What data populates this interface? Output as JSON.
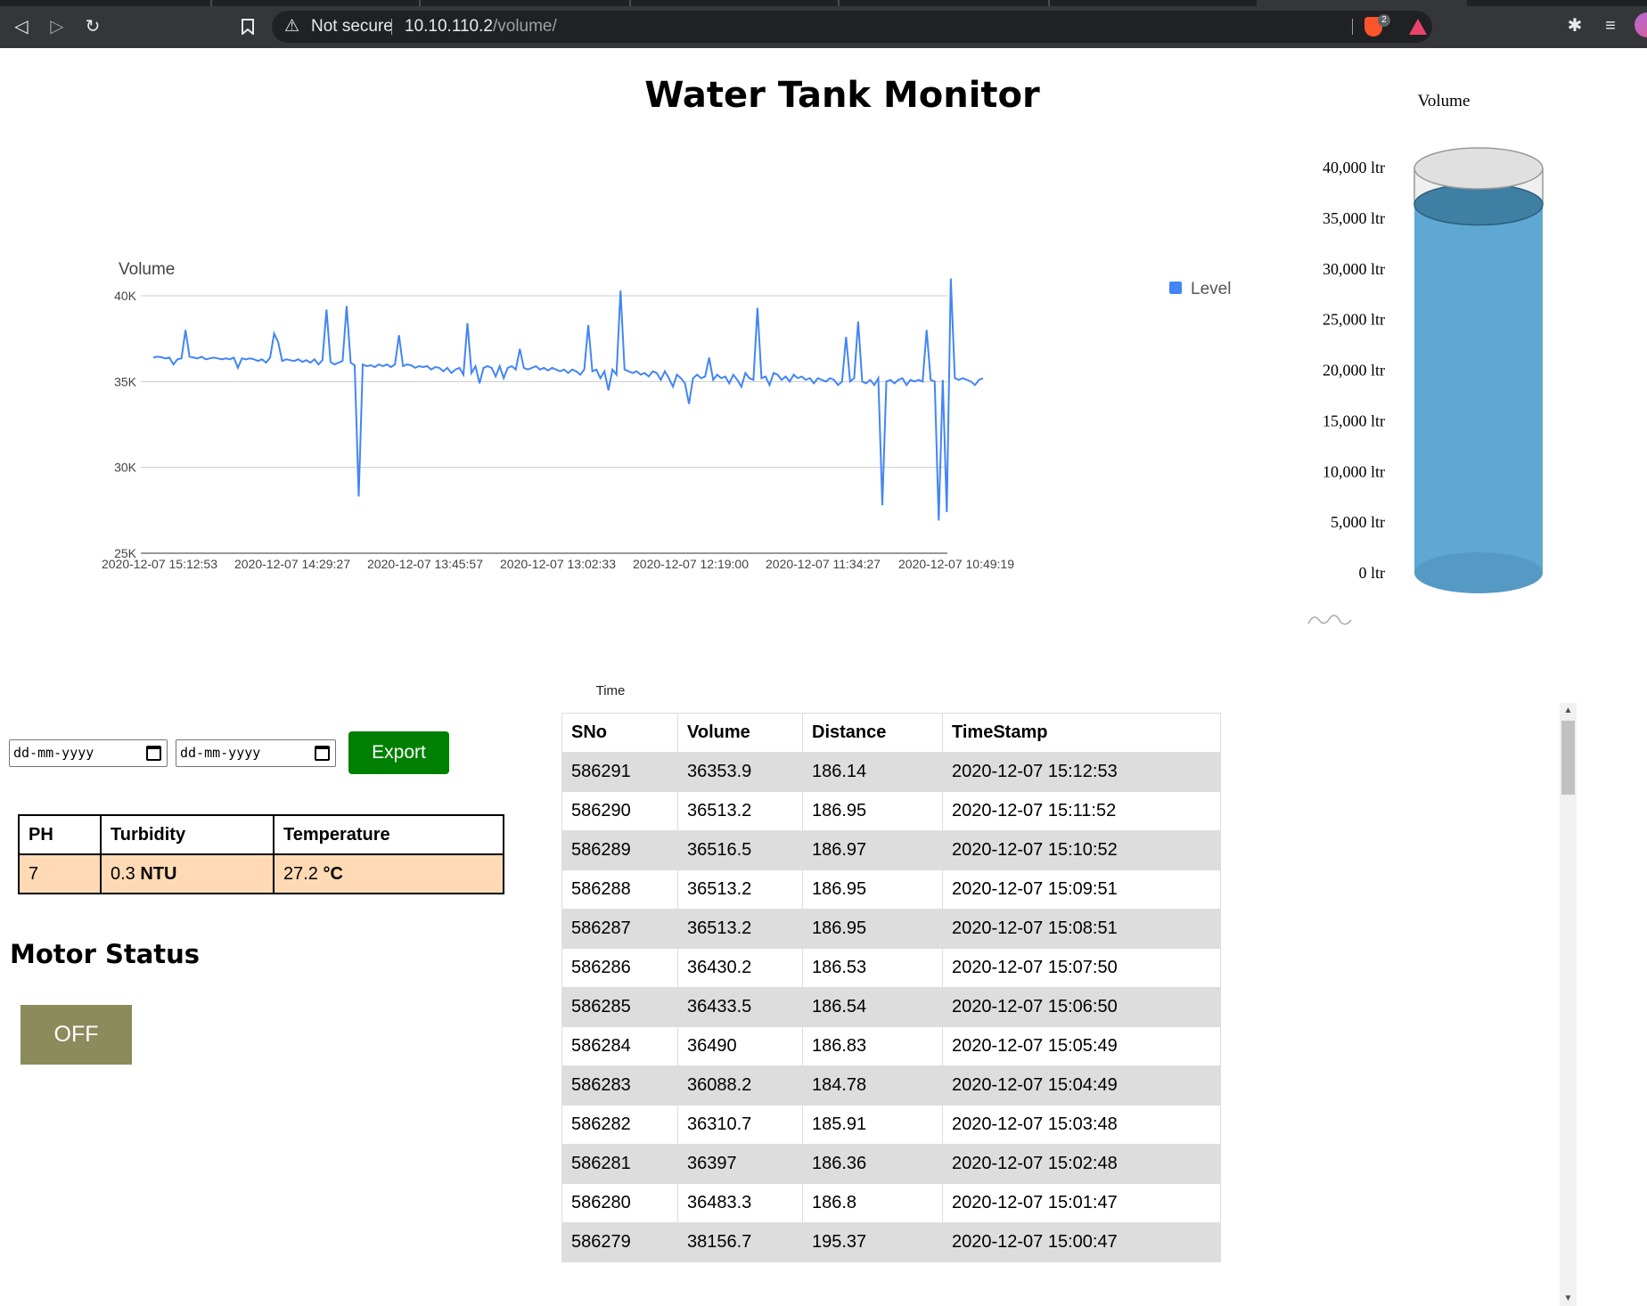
{
  "browser": {
    "security_label": "Not secure",
    "url_host": "10.10.110.2",
    "url_path": "/volume/",
    "brave_badge_count": "2",
    "icons": [
      "back-icon",
      "forward-icon",
      "reload-icon",
      "bookmark-icon",
      "warning-icon",
      "brave-shield-icon",
      "brave-rewards-icon",
      "extensions-icon",
      "media-queue-icon",
      "profile-avatar"
    ]
  },
  "page": {
    "title": "Water Tank Monitor"
  },
  "chart_data": [
    {
      "type": "line",
      "title": "Volume",
      "xlabel": "Time",
      "ylabel": "",
      "ylim": [
        25000,
        40000
      ],
      "y_ticks": [
        "40K",
        "35K",
        "30K",
        "25K"
      ],
      "y_tick_values": [
        40000,
        35000,
        30000,
        25000
      ],
      "x_tick_labels": [
        "2020-12-07 15:12:53",
        "2020-12-07 14:29:27",
        "2020-12-07 13:45:57",
        "2020-12-07 13:02:33",
        "2020-12-07 12:19:00",
        "2020-12-07 11:34:27",
        "2020-12-07 10:49:19"
      ],
      "legend": "right",
      "grid": true,
      "series": [
        {
          "name": "Level",
          "color": "#4285f4",
          "values": [
            36400,
            36450,
            36420,
            36350,
            36400,
            36000,
            36300,
            36350,
            38000,
            36450,
            36400,
            36350,
            36450,
            36300,
            36350,
            36400,
            36350,
            36300,
            36350,
            36300,
            36400,
            35800,
            36350,
            36300,
            36350,
            36300,
            36200,
            36300,
            36100,
            36400,
            37800,
            37300,
            36200,
            36300,
            36250,
            36200,
            36300,
            36150,
            36250,
            36100,
            36300,
            36000,
            36250,
            39200,
            36150,
            36000,
            36100,
            36200,
            39400,
            36100,
            35950,
            28300,
            36000,
            35900,
            35950,
            35850,
            36000,
            35900,
            36000,
            35850,
            36000,
            37700,
            35900,
            36000,
            35950,
            35800,
            35900,
            35850,
            35900,
            35700,
            35850,
            35800,
            35600,
            35800,
            35500,
            35700,
            35800,
            35400,
            38400,
            35500,
            35900,
            34900,
            35800,
            35900,
            35800,
            35300,
            35900,
            35200,
            35800,
            35900,
            35700,
            36900,
            35800,
            35700,
            35800,
            35900,
            35700,
            35800,
            35650,
            35800,
            35700,
            35600,
            35700,
            35500,
            35700,
            35600,
            35400,
            35700,
            38300,
            35600,
            35700,
            35200,
            35600,
            34500,
            35700,
            35400,
            40300,
            35700,
            35600,
            35500,
            35600,
            35400,
            35500,
            35300,
            35600,
            35500,
            35100,
            35600,
            35200,
            34700,
            35400,
            35200,
            34900,
            33700,
            35200,
            35400,
            35200,
            35300,
            36400,
            35100,
            35400,
            35200,
            35300,
            34900,
            35400,
            35100,
            34700,
            35500,
            35200,
            35100,
            39300,
            35200,
            35300,
            34800,
            35500,
            35400,
            35100,
            35300,
            35000,
            35400,
            35200,
            35300,
            35100,
            35200,
            34900,
            35200,
            35100,
            35000,
            35200,
            35100,
            34800,
            35000,
            37600,
            35000,
            35200,
            38500,
            35000,
            34900,
            35100,
            34800,
            35200,
            27800,
            35000,
            35100,
            34900,
            35100,
            35200,
            34800,
            35100,
            35000,
            35100,
            35000,
            38000,
            35100,
            35000,
            26900,
            35100,
            27400,
            41000,
            35200,
            35100,
            35200,
            35100,
            35000,
            34800,
            35100,
            35200
          ]
        }
      ]
    },
    {
      "type": "bar",
      "title": "Volume",
      "ylim": [
        0,
        40000
      ],
      "y_tick_labels": [
        "40,000 ltr",
        "35,000 ltr",
        "30,000 ltr",
        "25,000 ltr",
        "20,000 ltr",
        "15,000 ltr",
        "10,000 ltr",
        "5,000 ltr",
        "0 ltr"
      ],
      "y_tick_values": [
        40000,
        35000,
        30000,
        25000,
        20000,
        15000,
        10000,
        5000,
        0
      ],
      "values": [
        36353.9
      ],
      "colors": {
        "fill": "#5fa8d3",
        "top": "#3f7fa3",
        "empty": "#e0e0e0"
      }
    }
  ],
  "export": {
    "from_placeholder": "dd-mm-yyyy",
    "to_placeholder": "dd-mm-yyyy",
    "button_label": "Export",
    "button_color": "#008000"
  },
  "sensors": {
    "headers": [
      "PH",
      "Turbidity",
      "Temperature"
    ],
    "ph": "7",
    "turbidity_value": "0.3",
    "turbidity_unit": "NTU",
    "temperature_value": "27.2",
    "temperature_unit": "°C",
    "row_color": "#ffdab5"
  },
  "motor": {
    "title": "Motor Status",
    "state_label": "OFF",
    "button_color": "#8b8b5c"
  },
  "readings_table": {
    "headers": [
      "SNo",
      "Volume",
      "Distance",
      "TimeStamp"
    ],
    "rows": [
      [
        "586291",
        "36353.9",
        "186.14",
        "2020-12-07 15:12:53"
      ],
      [
        "586290",
        "36513.2",
        "186.95",
        "2020-12-07 15:11:52"
      ],
      [
        "586289",
        "36516.5",
        "186.97",
        "2020-12-07 15:10:52"
      ],
      [
        "586288",
        "36513.2",
        "186.95",
        "2020-12-07 15:09:51"
      ],
      [
        "586287",
        "36513.2",
        "186.95",
        "2020-12-07 15:08:51"
      ],
      [
        "586286",
        "36430.2",
        "186.53",
        "2020-12-07 15:07:50"
      ],
      [
        "586285",
        "36433.5",
        "186.54",
        "2020-12-07 15:06:50"
      ],
      [
        "586284",
        "36490",
        "186.83",
        "2020-12-07 15:05:49"
      ],
      [
        "586283",
        "36088.2",
        "184.78",
        "2020-12-07 15:04:49"
      ],
      [
        "586282",
        "36310.7",
        "185.91",
        "2020-12-07 15:03:48"
      ],
      [
        "586281",
        "36397",
        "186.36",
        "2020-12-07 15:02:48"
      ],
      [
        "586280",
        "36483.3",
        "186.8",
        "2020-12-07 15:01:47"
      ],
      [
        "586279",
        "38156.7",
        "195.37",
        "2020-12-07 15:00:47"
      ]
    ]
  }
}
